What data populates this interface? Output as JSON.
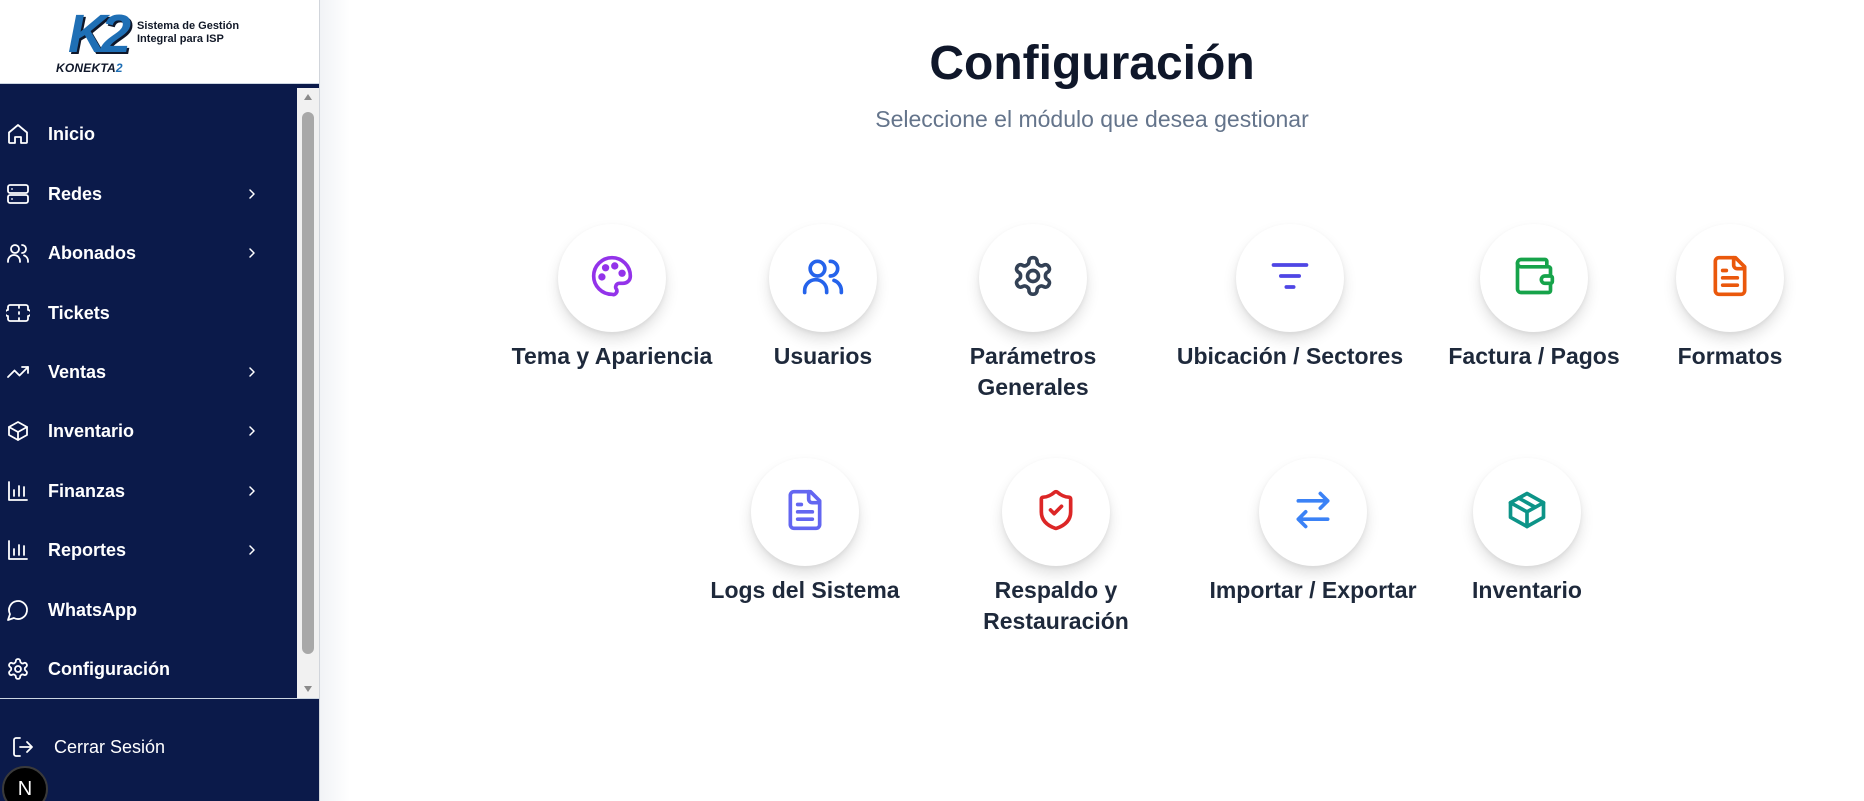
{
  "brand": {
    "logo_mark": "K2",
    "logo_name_prefix": "KONEKTA",
    "logo_name_suffix": "2",
    "tagline": "Sistema de Gestión Integral para ISP"
  },
  "sidebar": {
    "items": [
      {
        "label": "Inicio",
        "icon": "home-icon",
        "has_submenu": false
      },
      {
        "label": "Redes",
        "icon": "server-icon",
        "has_submenu": true
      },
      {
        "label": "Abonados",
        "icon": "users-icon",
        "has_submenu": true
      },
      {
        "label": "Tickets",
        "icon": "ticket-icon",
        "has_submenu": false
      },
      {
        "label": "Ventas",
        "icon": "trending-up-icon",
        "has_submenu": true
      },
      {
        "label": "Inventario",
        "icon": "box-icon",
        "has_submenu": true
      },
      {
        "label": "Finanzas",
        "icon": "bar-chart-icon",
        "has_submenu": true
      },
      {
        "label": "Reportes",
        "icon": "bar-chart-icon",
        "has_submenu": true
      },
      {
        "label": "WhatsApp",
        "icon": "message-circle-icon",
        "has_submenu": false
      },
      {
        "label": "Configuración",
        "icon": "gear-icon",
        "has_submenu": false
      }
    ],
    "logout_label": "Cerrar Sesión",
    "badge_letter": "N",
    "colors": {
      "background": "#0b1a4a",
      "text": "#ffffff"
    }
  },
  "main": {
    "title": "Configuración",
    "subtitle": "Seleccione el módulo que desea gestionar",
    "modules": [
      {
        "label": "Tema y Apariencia",
        "icon": "palette-icon",
        "color": "#9333ea"
      },
      {
        "label": "Usuarios",
        "icon": "users-icon",
        "color": "#2563eb"
      },
      {
        "label": "Parámetros Generales",
        "icon": "gear-icon",
        "color": "#334155"
      },
      {
        "label": "Ubicación / Sectores",
        "icon": "filter-icon",
        "color": "#4f46e5"
      },
      {
        "label": "Factura / Pagos",
        "icon": "wallet-icon",
        "color": "#16a34a"
      },
      {
        "label": "Formatos",
        "icon": "file-text-icon",
        "color": "#ea580c"
      },
      {
        "label": "Logs del Sistema",
        "icon": "file-text-icon",
        "color": "#6366f1"
      },
      {
        "label": "Respaldo y Restauración",
        "icon": "shield-check-icon",
        "color": "#dc2626"
      },
      {
        "label": "Importar / Exportar",
        "icon": "arrows-exchange-icon",
        "color": "#3b82f6"
      },
      {
        "label": "Inventario",
        "icon": "box-icon",
        "color": "#0d9488"
      }
    ]
  }
}
